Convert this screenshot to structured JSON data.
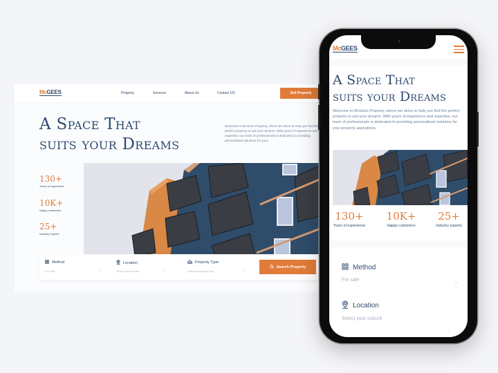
{
  "brand": {
    "logo_mc": "Mc",
    "logo_gees": "GEES",
    "accent_color": "#e07b39",
    "primary_color": "#2d4a6e"
  },
  "desktop": {
    "nav": {
      "links": [
        "Property",
        "Services",
        "About Us",
        "Contact US"
      ],
      "cta_label": "Sell Property"
    },
    "hero": {
      "title_line1": "A Space That",
      "title_line2": "suits your Dreams",
      "description": "Welcome to McGees Property, where we strive to help you find the perfect property to suit your dreams. With years of experience and expertise, our team of professionals is dedicated to providing personalised solutions for your"
    },
    "stats": [
      {
        "value": "130+",
        "label": "Years of experience"
      },
      {
        "value": "10K+",
        "label": "Happy customers"
      },
      {
        "value": "25+",
        "label": "Industry experts"
      }
    ],
    "search": {
      "fields": [
        {
          "icon": "grid-icon",
          "label": "Method",
          "value": "For sale"
        },
        {
          "icon": "location-pin-icon",
          "label": "Location",
          "value": "Select your suburb"
        },
        {
          "icon": "house-icon",
          "label": "Property Type",
          "value": "Choose property type"
        }
      ],
      "button_label": "Search Property"
    }
  },
  "mobile": {
    "menu_icon": "hamburger-icon",
    "hero": {
      "title_line1": "A Space That",
      "title_line2": "suits your Dreams",
      "description": "Welcome to McGees Property, where we strive to help you find the perfect property to suit your dreams. With years of experience and expertise, our team of professionals is dedicated to providing personalised solutions for your property aspirations."
    },
    "stats": [
      {
        "value": "130+",
        "label": "Years of experience"
      },
      {
        "value": "10K+",
        "label": "Happy customers"
      },
      {
        "value": "25+",
        "label": "Industry experts"
      }
    ],
    "search": {
      "fields": [
        {
          "icon": "grid-icon",
          "label": "Method",
          "value": "For sale"
        },
        {
          "icon": "location-pin-icon",
          "label": "Location",
          "value": "Select your suburb"
        }
      ]
    }
  }
}
